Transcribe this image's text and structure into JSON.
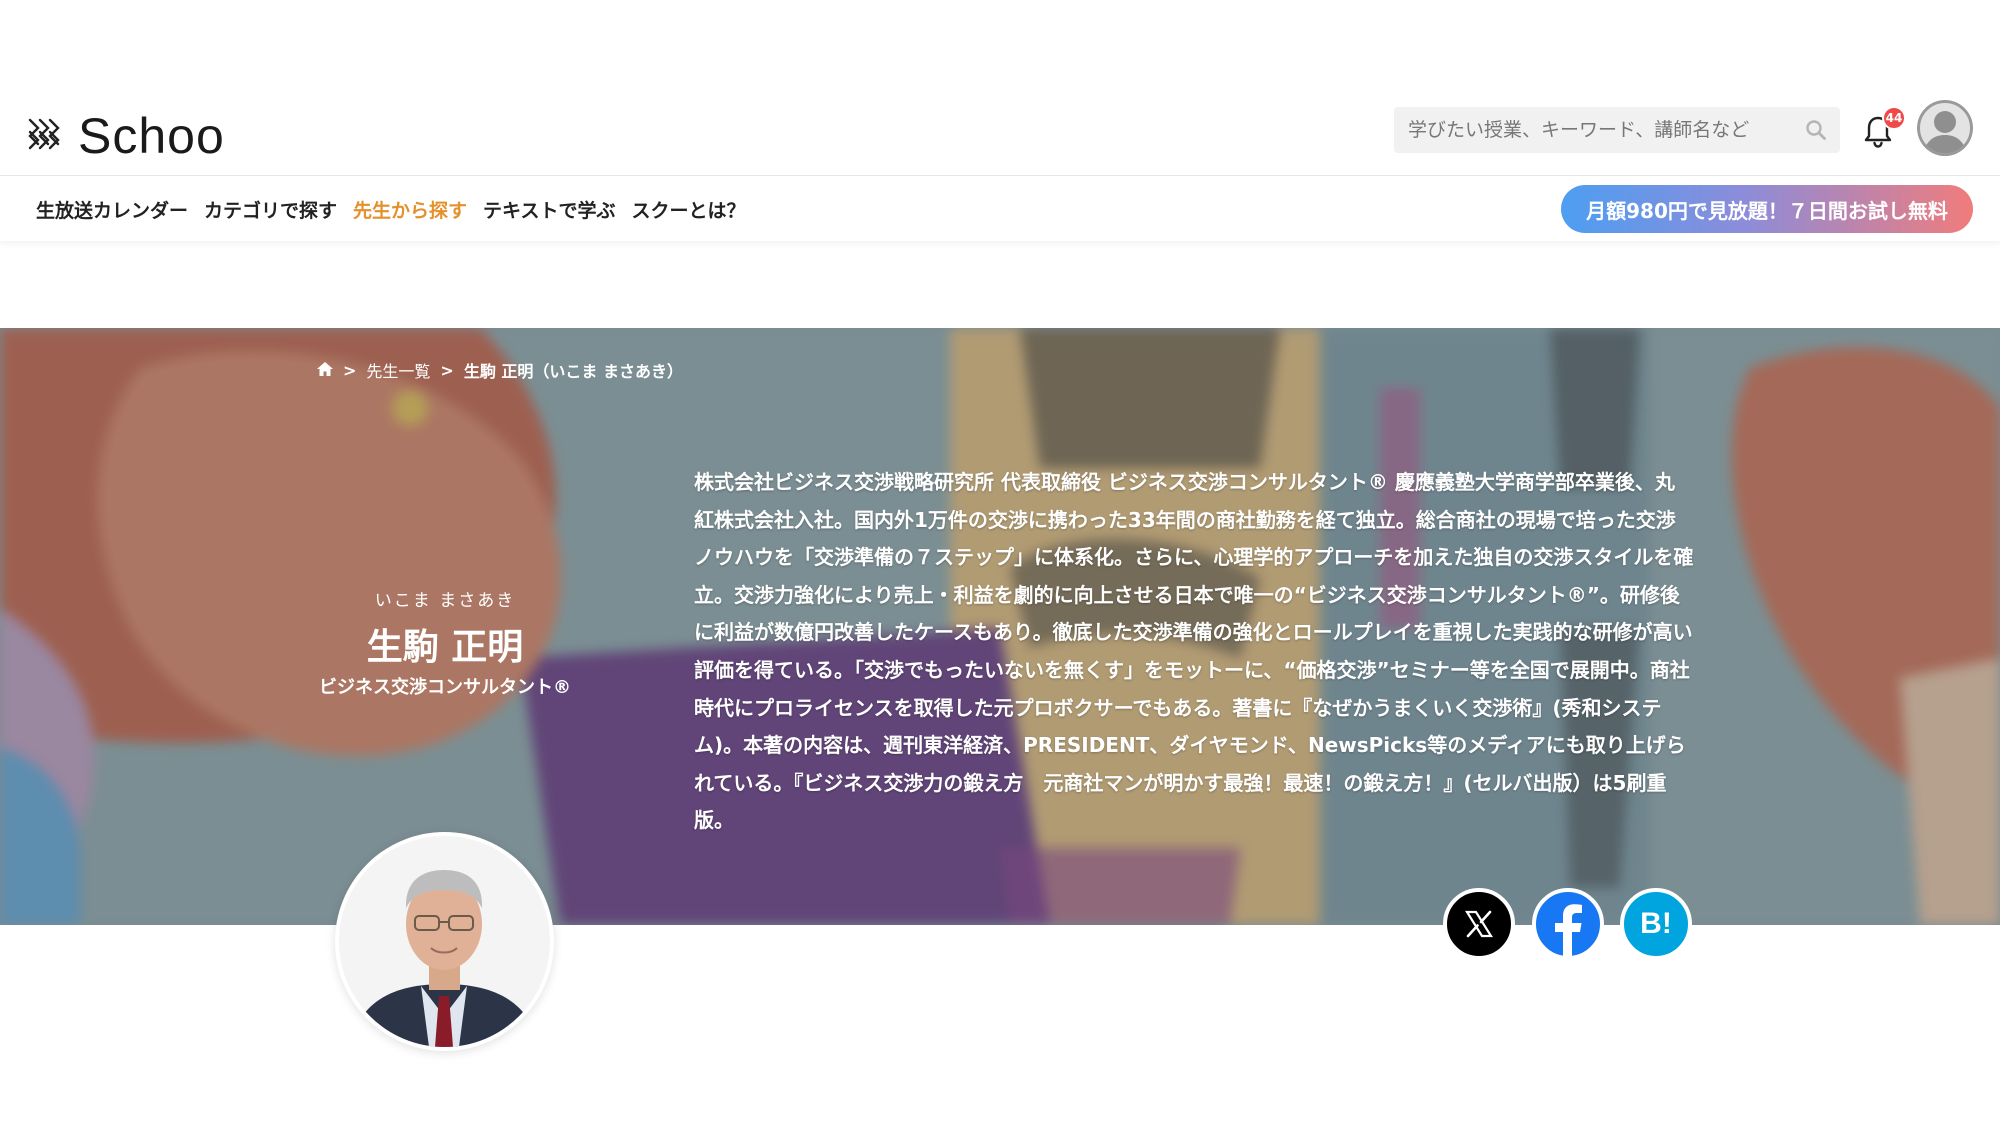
{
  "header": {
    "logo_text": "Schoo",
    "search": {
      "placeholder": "学びたい授業、キーワード、講師名など",
      "value": ""
    },
    "notifications_count": "44"
  },
  "nav": {
    "links": [
      "生放送カレンダー",
      "カテゴリで探す",
      "先生から探す",
      "テキストで学ぶ",
      "スクーとは？"
    ],
    "active_index": 2,
    "cta_label": "月額980円で見放題！７日間お試し無料"
  },
  "breadcrumb": {
    "list": "先生一覧",
    "current": "生駒 正明（いこま まさあき）"
  },
  "teacher": {
    "kana": "いこま まさあき",
    "name": "生駒 正明",
    "title": "ビジネス交渉コンサルタント®",
    "bio": "株式会社ビジネス交渉戦略研究所 代表取締役 ビジネス交渉コンサルタント® 慶應義塾大学商学部卒業後、丸紅株式会社入社。国内外1万件の交渉に携わった33年間の商社勤務を経て独立。総合商社の現場で培った交渉ノウハウを「交渉準備の７ステップ」に体系化。さらに、心理学的アプローチを加えた独自の交渉スタイルを確立。交渉力強化により売上・利益を劇的に向上させる日本で唯一の“ビジネス交渉コンサルタント®”。研修後に利益が数億円改善したケースもあり。徹底した交渉準備の強化とロールプレイを重視した実践的な研修が高い評価を得ている。「交渉でもったいないを無くす」をモットーに、“価格交渉”セミナー等を全国で展開中。商社時代にプロライセンスを取得した元プロボクサーでもある。著書に『なぜかうまくいく交渉術』(秀和システム)。本著の内容は、週刊東洋経済、PRESIDENT、ダイヤモンド、NewsPicks等のメディアにも取り上げられている。『ビジネス交渉力の鍛え方　元商社マンが明かす最強！最速！の鍛え方！』(セルバ出版）は5刷重版。"
  },
  "share": {
    "hatena_label": "B!"
  },
  "colors": {
    "accent_orange": "#e4902c",
    "badge_red": "#ef4a4a",
    "x_black": "#000000",
    "facebook_blue": "#1877f2",
    "hatena_blue": "#00a4de"
  },
  "icons": [
    "schoo-logo-icon",
    "search-icon",
    "bell-icon",
    "user-avatar-icon",
    "home-icon",
    "x-icon",
    "facebook-icon",
    "hatena-bookmark-icon"
  ]
}
